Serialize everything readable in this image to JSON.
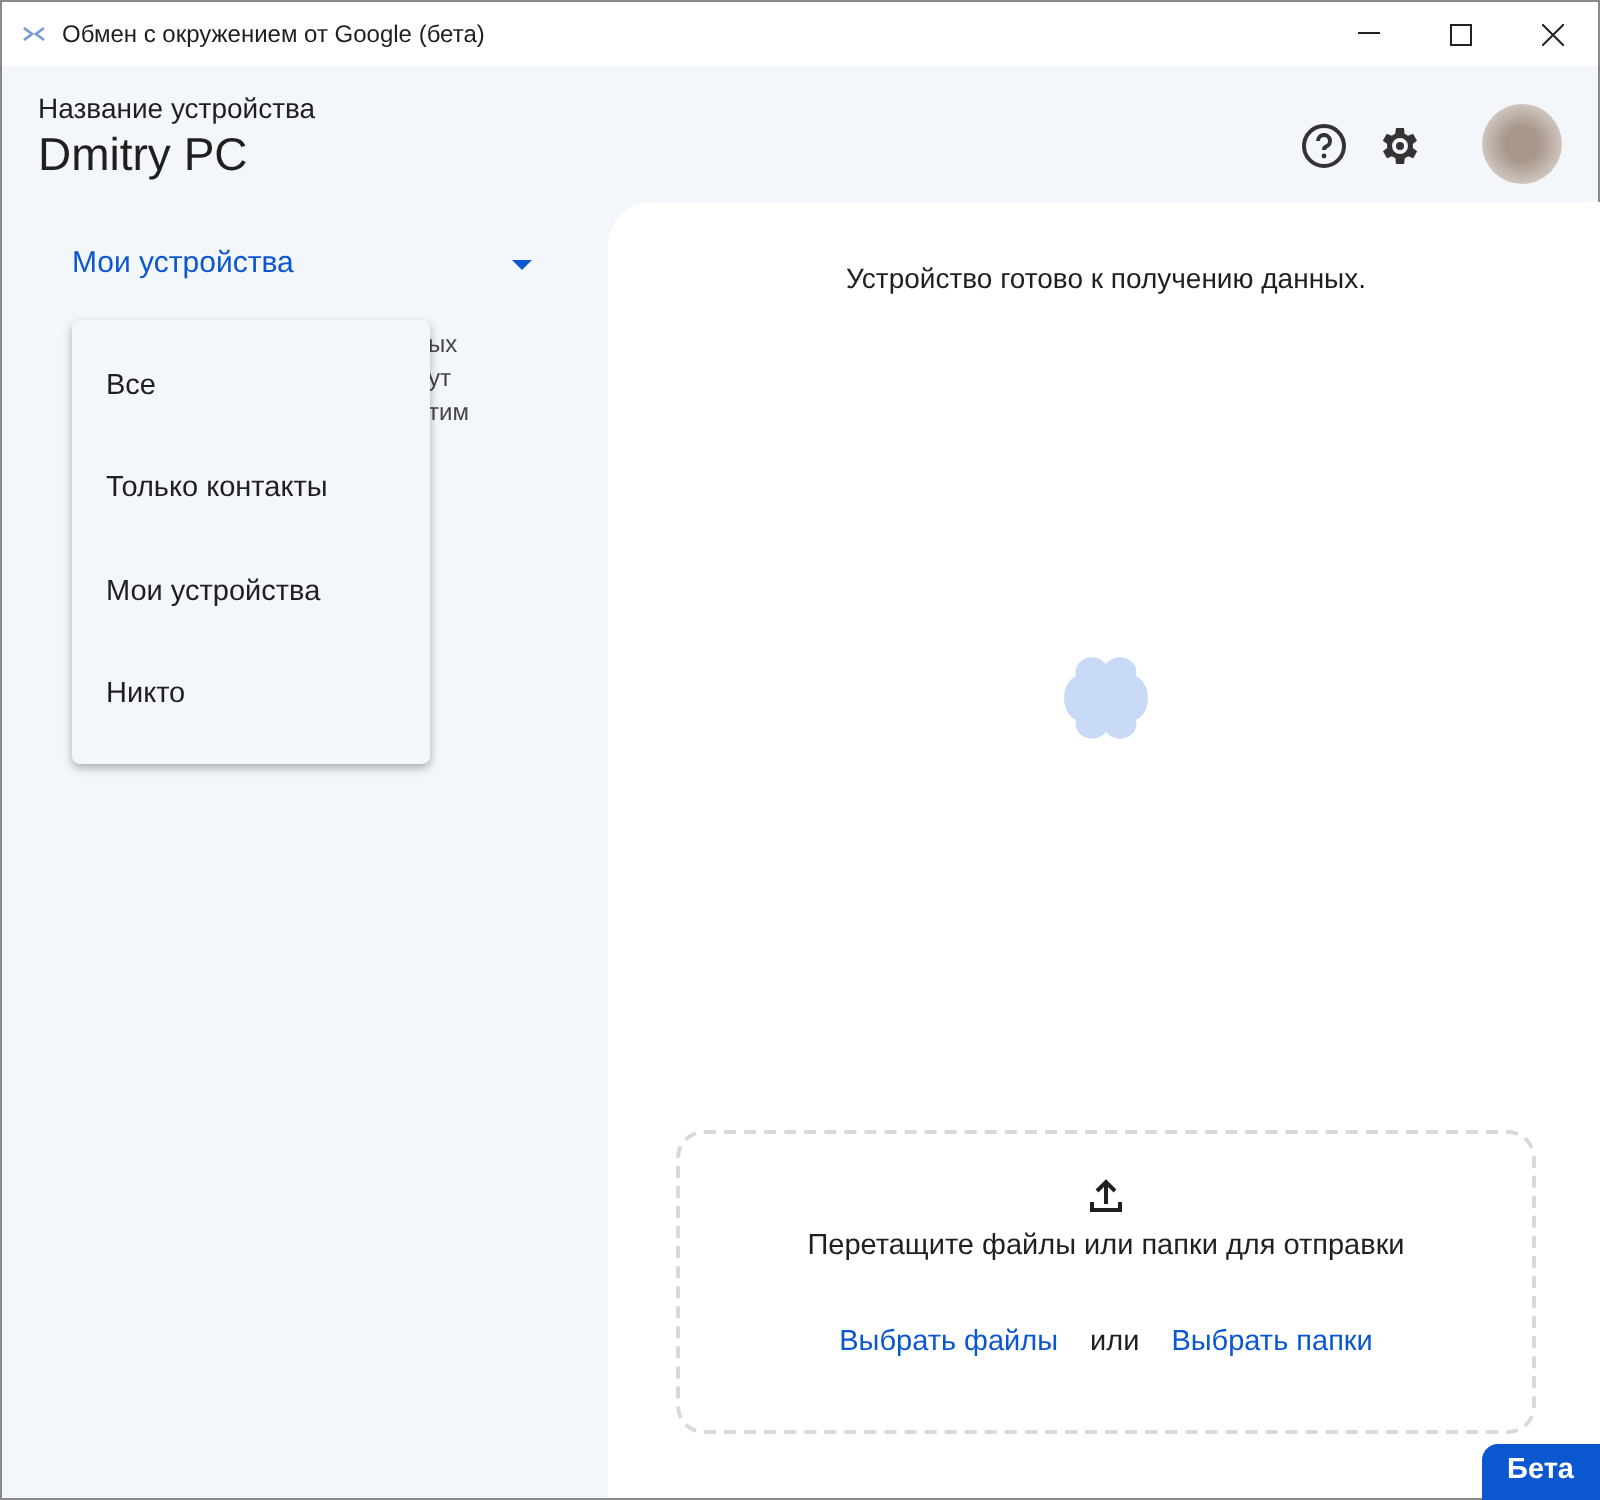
{
  "window": {
    "title": "Обмен с окружением от Google (бета)"
  },
  "header": {
    "label": "Название устройства",
    "device_name": "Dmitry PC"
  },
  "visibility": {
    "value": "Мои устройства",
    "expanded": true,
    "options": [
      {
        "label": "Все"
      },
      {
        "label": "Только контакты"
      },
      {
        "label": "Мои устройства"
      },
      {
        "label": "Никто"
      }
    ],
    "description_fragments": [
      "ых",
      "ут",
      "тим"
    ]
  },
  "main": {
    "status": "Устройство готово к получению данных.",
    "drop_zone": {
      "prompt": "Перетащите файлы или папки для отправки",
      "choose_files": "Выбрать файлы",
      "separator": "или",
      "choose_folders": "Выбрать папки"
    }
  },
  "badge": "Бета"
}
